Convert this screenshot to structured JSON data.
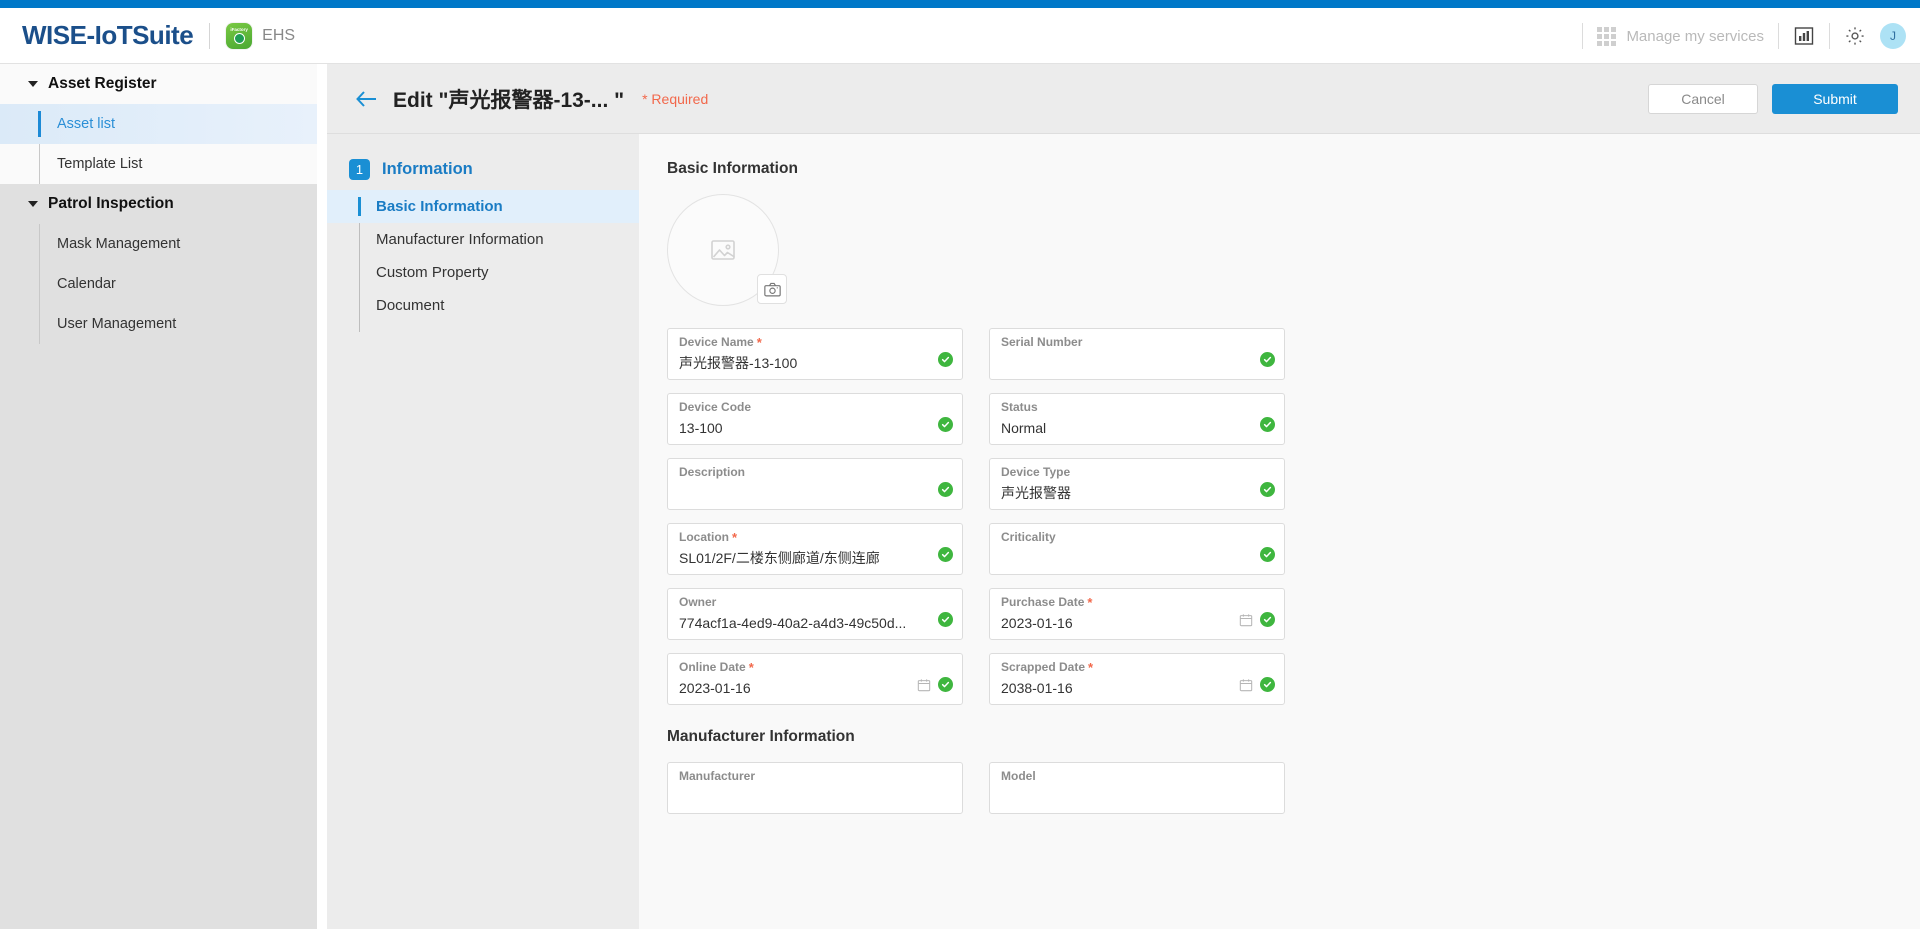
{
  "header": {
    "brand": "WISE-IoTSuite",
    "app_icon_caption": "iFactory",
    "app_name": "EHS",
    "manage_services": "Manage my services",
    "avatar_initial": "J",
    "accent_blue": "#0078c8"
  },
  "sidebar": {
    "groups": [
      {
        "label": "Asset Register",
        "items": [
          {
            "label": "Asset list",
            "active": true
          },
          {
            "label": "Template List",
            "active": false
          }
        ]
      },
      {
        "label": "Patrol Inspection",
        "items": [
          {
            "label": "Mask Management",
            "active": false
          },
          {
            "label": "Calendar",
            "active": false
          },
          {
            "label": "User Management",
            "active": false
          }
        ]
      }
    ]
  },
  "titlebar": {
    "title": "Edit \"声光报警器-13-... \"",
    "required_note": "* Required",
    "cancel_label": "Cancel",
    "submit_label": "Submit"
  },
  "formnav": {
    "step_number": "1",
    "step_label": "Information",
    "subitems": [
      {
        "label": "Basic Information",
        "active": true
      },
      {
        "label": "Manufacturer Information",
        "active": false
      },
      {
        "label": "Custom Property",
        "active": false
      },
      {
        "label": "Document",
        "active": false
      }
    ]
  },
  "form": {
    "section_basic": "Basic Information",
    "section_manufacturer": "Manufacturer Information",
    "fields": [
      {
        "label": "Device Name",
        "required": true,
        "value": "声光报警器-13-100",
        "valid": true,
        "calendar": false
      },
      {
        "label": "Serial Number",
        "required": false,
        "value": "",
        "valid": true,
        "calendar": false
      },
      {
        "label": "Device Code",
        "required": false,
        "value": "13-100",
        "valid": true,
        "calendar": false
      },
      {
        "label": "Status",
        "required": false,
        "value": "Normal",
        "valid": true,
        "calendar": false
      },
      {
        "label": "Description",
        "required": false,
        "value": "",
        "valid": true,
        "calendar": false
      },
      {
        "label": "Device Type",
        "required": false,
        "value": "声光报警器",
        "valid": true,
        "calendar": false
      },
      {
        "label": "Location",
        "required": true,
        "value": "SL01/2F/二楼东侧廊道/东侧连廊",
        "valid": true,
        "calendar": false
      },
      {
        "label": "Criticality",
        "required": false,
        "value": "",
        "valid": true,
        "calendar": false
      },
      {
        "label": "Owner",
        "required": false,
        "value": "774acf1a-4ed9-40a2-a4d3-49c50d...",
        "valid": true,
        "calendar": false
      },
      {
        "label": "Purchase Date",
        "required": true,
        "value": "2023-01-16",
        "valid": true,
        "calendar": true
      },
      {
        "label": "Online Date",
        "required": true,
        "value": "2023-01-16",
        "valid": true,
        "calendar": true
      },
      {
        "label": "Scrapped Date",
        "required": true,
        "value": "2038-01-16",
        "valid": true,
        "calendar": true
      }
    ],
    "manufacturer_fields": [
      {
        "label": "Manufacturer",
        "required": false,
        "value": "",
        "valid": false,
        "calendar": false
      },
      {
        "label": "Model",
        "required": false,
        "value": "",
        "valid": false,
        "calendar": false
      }
    ]
  }
}
